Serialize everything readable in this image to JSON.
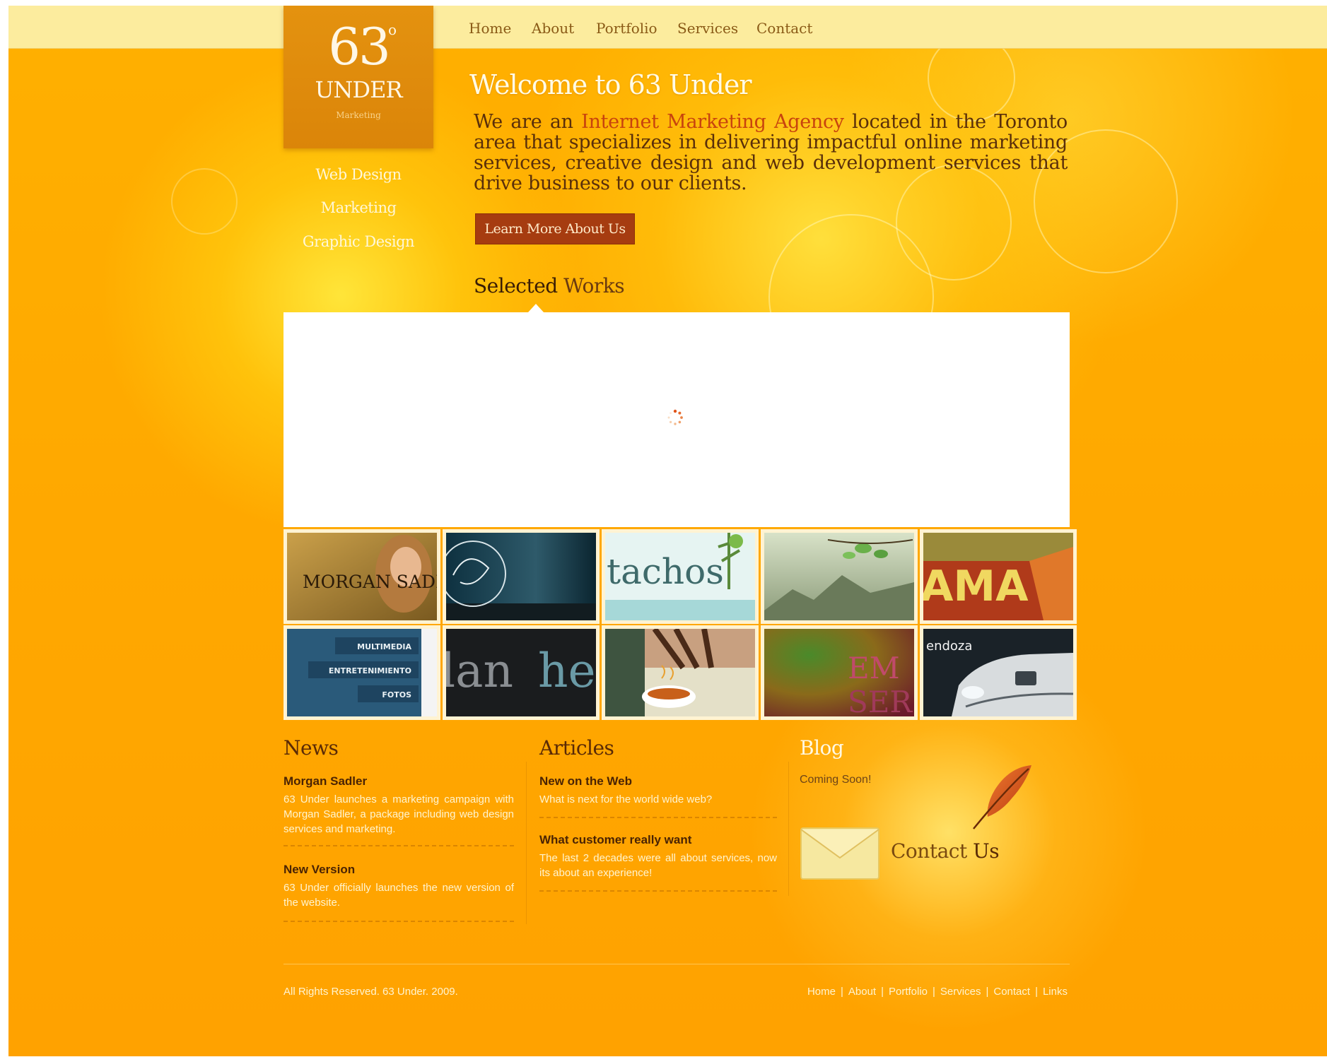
{
  "brand": {
    "number": "63",
    "degree": "o",
    "name": "UNDER",
    "tagline": "Marketing"
  },
  "nav": [
    "Home",
    "About",
    "Portfolio",
    "Services",
    "Contact"
  ],
  "side_menu": [
    "Web Design",
    "Marketing",
    "Graphic Design"
  ],
  "hero": {
    "title": "Welcome to 63 Under",
    "intro_before": "We are an ",
    "intro_highlight": "Internet Marketing Agency",
    "intro_after": " located in the Toronto area that specializes in delivering impactful online marketing services, creative design and web development services that drive business to our clients.",
    "button": "Learn More About Us"
  },
  "works": {
    "heading_strong": "Selected",
    "heading_rest": " Works",
    "thumbnails": [
      {
        "label": "MORGAN SADLER",
        "icon": "morgan-sadler-thumbnail"
      },
      {
        "label": "",
        "icon": "script-logo-thumbnail"
      },
      {
        "label": "tachos",
        "icon": "tachos-thumbnail"
      },
      {
        "label": "",
        "icon": "landscape-leaves-thumbnail"
      },
      {
        "label": "AMA",
        "icon": "ama-thumbnail"
      },
      {
        "label": "MULTIMEDIA",
        "label2": "ENTRETENIMIENTO",
        "label3": "FOTOS",
        "icon": "multimedia-menu-thumbnail"
      },
      {
        "label": "lan",
        "label2": "he",
        "icon": "dark-text-thumbnail"
      },
      {
        "label": "",
        "icon": "coffee-cup-thumbnail"
      },
      {
        "label": "EM",
        "label2": "SER",
        "icon": "green-red-abstract-thumbnail"
      },
      {
        "label": "endoza",
        "icon": "car-thumbnail"
      }
    ]
  },
  "news": {
    "title": "News",
    "items": [
      {
        "title": "Morgan Sadler",
        "text": "63 Under launches a marketing campaign with Morgan Sadler, a package including web design services and marketing."
      },
      {
        "title": "New Version",
        "text": "63 Under officially launches the new version of the website."
      }
    ]
  },
  "articles": {
    "title": "Articles",
    "items": [
      {
        "title": "New on the Web",
        "text": "What is next for the world wide web?"
      },
      {
        "title": "What customer really want",
        "text": "The last 2 decades were all about services, now its about an experience!"
      }
    ]
  },
  "blog": {
    "title": "Blog",
    "status": "Coming Soon!",
    "contact_pre": "Contact ",
    "contact_strong": "Us"
  },
  "footer": {
    "copyright": "All Rights Reserved. 63 Under. 2009.",
    "links": [
      "Home",
      "About",
      "Portfolio",
      "Services",
      "Contact",
      "Links"
    ]
  },
  "colors": {
    "background": "#ffa800",
    "topbar": "#fcec9e",
    "logo": "#e08c0c",
    "button": "#a63c10",
    "highlight": "#c8430e"
  }
}
